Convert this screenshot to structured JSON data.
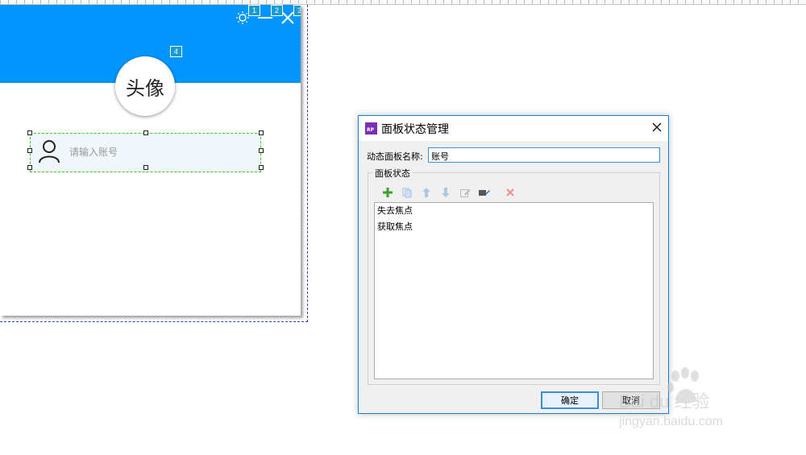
{
  "prototype": {
    "header_color": "#0095ff",
    "badges": [
      "1",
      "2",
      "3",
      "4"
    ],
    "avatar_text": "头像",
    "account_input": {
      "placeholder": "请输入账号",
      "icon": "user-icon"
    },
    "window_icons": [
      "sun-icon",
      "minimize-icon",
      "close-icon"
    ]
  },
  "dialog": {
    "logo_text": "RP",
    "title": "面板状态管理",
    "panel_name_label": "动态面板名称:",
    "panel_name_value": "账号",
    "states_group_label": "面板状态",
    "toolbar_icons": [
      "add-icon",
      "duplicate-icon",
      "move-up-icon",
      "move-down-icon",
      "edit-icon",
      "edit-all-icon",
      "delete-icon"
    ],
    "states": [
      "失去焦点",
      "获取焦点"
    ],
    "ok_label": "确定",
    "cancel_label": "取消"
  },
  "watermark": {
    "brand": "Bai du 经验",
    "url": "jingyan.baidu.com"
  }
}
